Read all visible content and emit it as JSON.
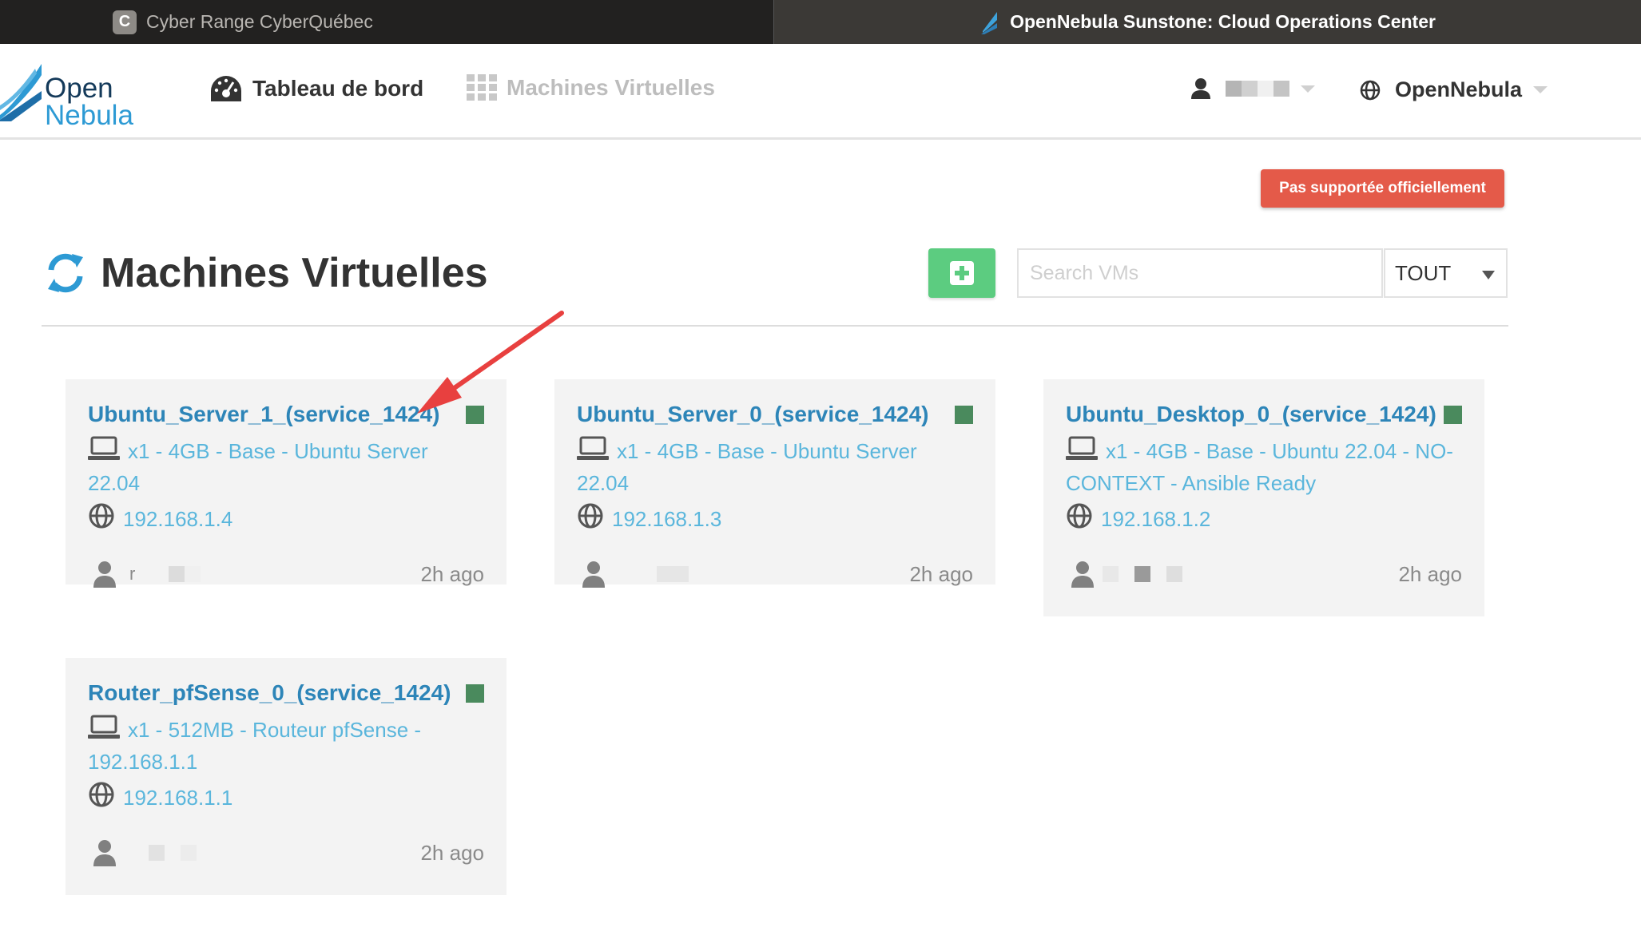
{
  "browser": {
    "tabs": [
      {
        "favicon": "C",
        "title": "Cyber Range CyberQuébec",
        "active": false
      },
      {
        "title": "OpenNebula Sunstone: Cloud Operations Center",
        "active": true
      }
    ]
  },
  "header": {
    "logo": {
      "line1": "Open",
      "line2": "Nebula"
    },
    "nav": [
      {
        "icon": "dashboard-icon",
        "label": "Tableau de bord"
      },
      {
        "icon": "grid-icon",
        "label": "Machines Virtuelles"
      }
    ],
    "user_icon": "user-icon",
    "zone": {
      "icon": "globe-icon",
      "label": "OpenNebula"
    }
  },
  "badge": "Pas supportée officiellement",
  "page": {
    "title": "Machines Virtuelles",
    "search_placeholder": "Search VMs",
    "filter_value": "TOUT"
  },
  "vms": [
    {
      "name": "Ubuntu_Server_1_(service_1424)",
      "state_color": "#4a8a5d",
      "template": "x1 - 4GB - Base - Ubuntu Server 22.04",
      "ip": "192.168.1.4",
      "owner_prefix": "r",
      "age": "2h ago"
    },
    {
      "name": "Ubuntu_Server_0_(service_1424)",
      "state_color": "#4a8a5d",
      "template": "x1 - 4GB - Base - Ubuntu Server 22.04",
      "ip": "192.168.1.3",
      "owner_prefix": "",
      "age": "2h ago"
    },
    {
      "name": "Ubuntu_Desktop_0_(service_1424)",
      "state_color": "#4a8a5d",
      "template": "x1 - 4GB - Base - Ubuntu 22.04 - NO-CONTEXT - Ansible Ready",
      "ip": "192.168.1.2",
      "owner_prefix": "",
      "age": "2h ago"
    },
    {
      "name": "Router_pfSense_0_(service_1424)",
      "state_color": "#4a8a5d",
      "template": "x1 - 512MB - Routeur pfSense - 192.168.1.1",
      "ip": "192.168.1.1",
      "owner_prefix": "",
      "age": "2h ago"
    }
  ],
  "colors": {
    "accent_link": "#2d85b8",
    "detail_text": "#5ab6dc",
    "running_state": "#4a8a5d",
    "badge_bg": "#e45a49",
    "add_button": "#5ccc80",
    "annotation_arrow": "#e8403f"
  }
}
